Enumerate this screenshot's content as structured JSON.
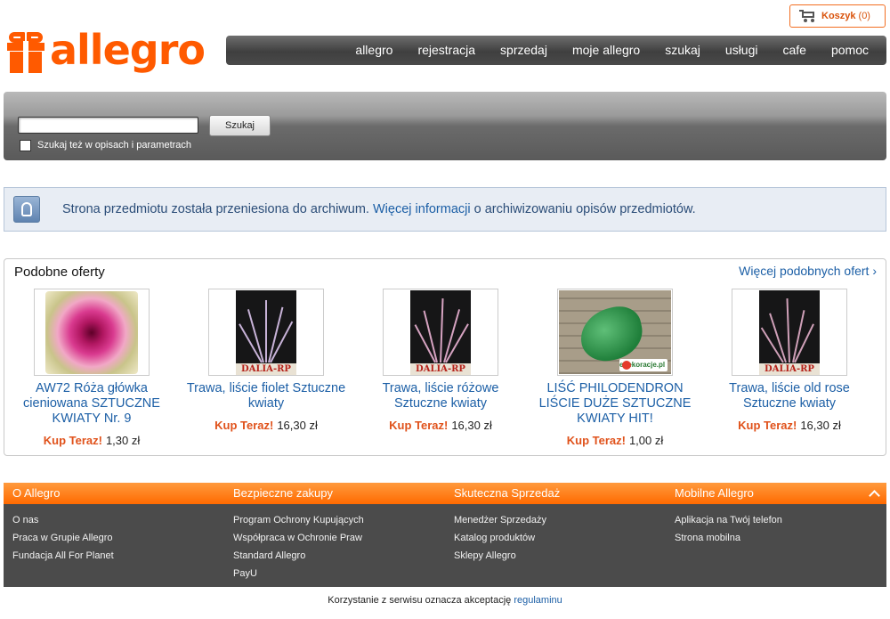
{
  "header": {
    "logo_text": "allegro",
    "cart": {
      "label": "Koszyk",
      "count": "(0)"
    },
    "nav": [
      "allegro",
      "rejestracja",
      "sprzedaj",
      "moje allegro",
      "szukaj",
      "usługi",
      "cafe",
      "pomoc"
    ]
  },
  "search": {
    "button_label": "Szukaj",
    "input_value": "",
    "checkbox_label": "Szukaj też w opisach i parametrach"
  },
  "notice": {
    "text_before": "Strona przedmiotu została przeniesiona do archiwum.",
    "link": "Więcej informacji",
    "text_after": "o archiwizowaniu opisów przedmiotów."
  },
  "similar": {
    "title": "Podobne oferty",
    "more_link": "Więcej podobnych ofert ›",
    "offers": [
      {
        "title": "AW72 Róża główka cieniowana SZTUCZNE KWIATY Nr. 9",
        "buy_label": "Kup Teraz!",
        "price": "1,30 zł",
        "image": "rose-photo"
      },
      {
        "title": "Trawa, liście fiolet Sztuczne kwiaty",
        "buy_label": "Kup Teraz!",
        "price": "16,30 zł",
        "image": "violet-grass-photo",
        "watermark": "DALIA-RP"
      },
      {
        "title": "Trawa, liście różowe Sztuczne kwiaty",
        "buy_label": "Kup Teraz!",
        "price": "16,30 zł",
        "image": "pink-grass-photo",
        "watermark": "DALIA-RP"
      },
      {
        "title": "LIŚĆ PHILODENDRON LIŚCIE DUŻE SZTUCZNE KWIATY HIT!",
        "buy_label": "Kup Teraz!",
        "price": "1,00 zł",
        "image": "leaf-photo",
        "watermark": "edekoracje.pl"
      },
      {
        "title": "Trawa, liście old rose Sztuczne kwiaty",
        "buy_label": "Kup Teraz!",
        "price": "16,30 zł",
        "image": "oldrose-grass-photo",
        "watermark": "DALIA-RP"
      }
    ]
  },
  "footer": {
    "columns": [
      {
        "title": "O Allegro",
        "links": [
          "O nas",
          "Praca w Grupie Allegro",
          "Fundacja All For Planet"
        ]
      },
      {
        "title": "Bezpieczne zakupy",
        "links": [
          "Program Ochrony Kupujących",
          "Współpraca w Ochronie Praw",
          "Standard Allegro",
          "PayU"
        ]
      },
      {
        "title": "Skuteczna Sprzedaż",
        "links": [
          "Menedżer Sprzedaży",
          "Katalog produktów",
          "Sklepy Allegro"
        ]
      },
      {
        "title": "Mobilne Allegro",
        "links": [
          "Aplikacja na Twój telefon",
          "Strona mobilna"
        ]
      }
    ],
    "terms_text": "Korzystanie z serwisu oznacza akceptację",
    "terms_link": "regulaminu"
  },
  "colors": {
    "brand": "#ff5a00",
    "link": "#1c5fa6",
    "buy_now": "#e0521b"
  },
  "icons": [
    "gift-logo-icon",
    "cart-icon",
    "lightbulb-icon",
    "chevron-up-icon"
  ]
}
